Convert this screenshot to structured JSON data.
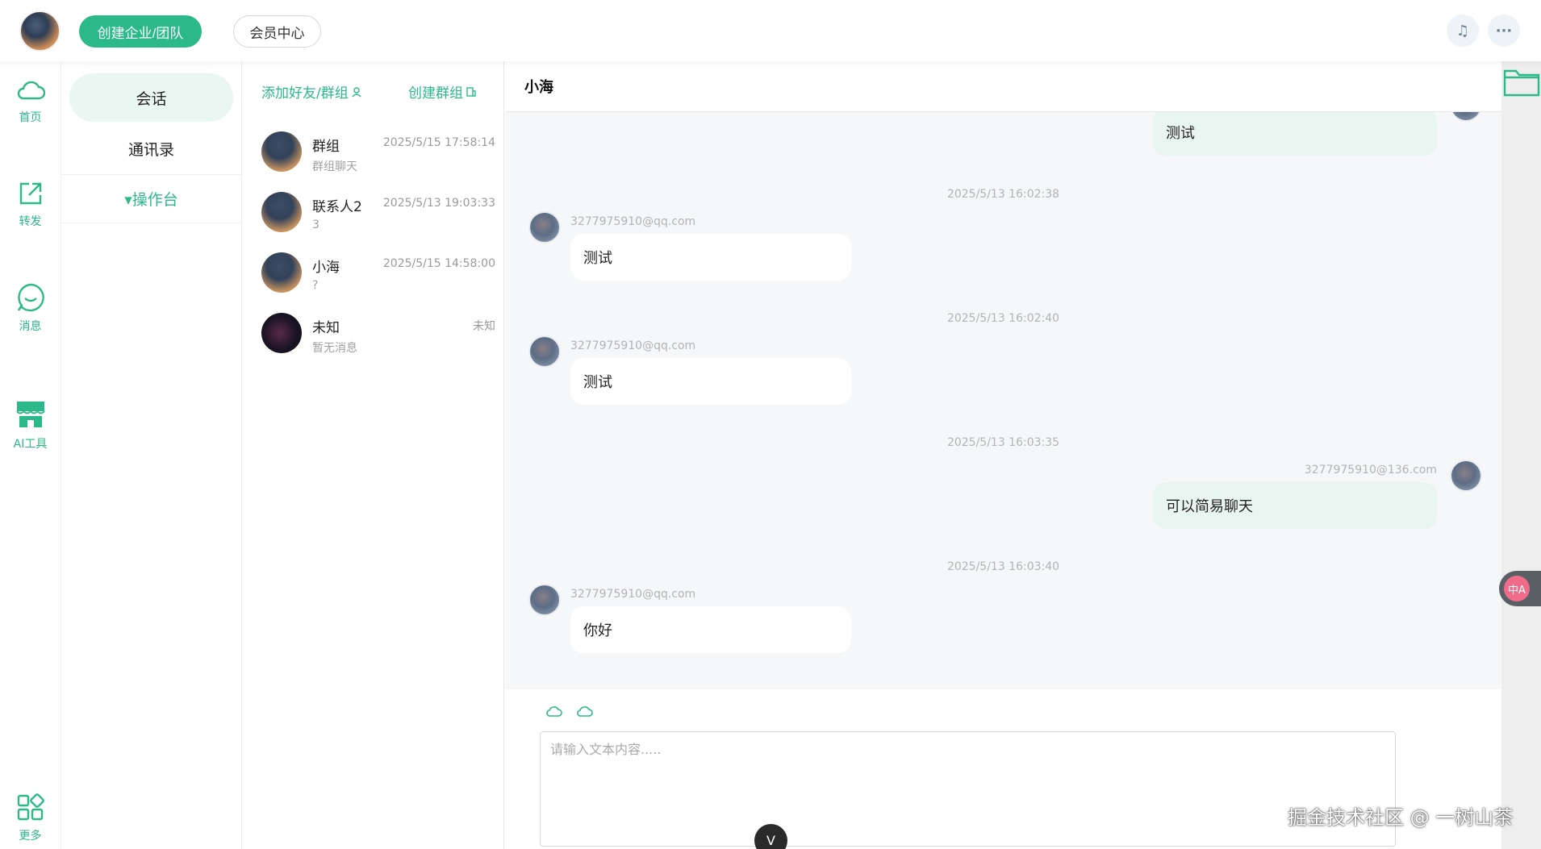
{
  "topbar": {
    "create_team_label": "创建企业/团队",
    "member_center_label": "会员中心",
    "icons": [
      "audio-icon",
      "more-icon"
    ],
    "more_glyph": "···",
    "audio_glyph": "♫"
  },
  "rail": {
    "items": [
      {
        "label": "首页",
        "icon": "cloud-icon"
      },
      {
        "label": "转发",
        "icon": "share-icon"
      },
      {
        "label": "消息",
        "icon": "message-icon"
      },
      {
        "label": "AI工具",
        "icon": "store-icon"
      },
      {
        "label": "更多",
        "icon": "grid-icon"
      }
    ]
  },
  "subnav": {
    "tabs": [
      "会话",
      "通讯录"
    ],
    "ops_label": "▾操作台"
  },
  "convlist": {
    "add_friend_label": "添加好友/群组",
    "create_group_label": "创建群组",
    "items": [
      {
        "name": "群组",
        "time": "2025/5/15 17:58:14",
        "preview": "群组聊天"
      },
      {
        "name": "联系人2",
        "time": "2025/5/13 19:03:33",
        "preview": "3"
      },
      {
        "name": "小海",
        "time": "2025/5/15 14:58:00",
        "preview": "?"
      },
      {
        "name": "未知",
        "time": "未知",
        "preview": "暂无消息"
      }
    ]
  },
  "chat": {
    "title": "小海",
    "messages": [
      {
        "dir": "out",
        "text": "测试"
      },
      {
        "dir": "in",
        "time": "2025/5/13 16:02:38",
        "sender": "3277975910@qq.com",
        "text": "测试"
      },
      {
        "dir": "in",
        "time": "2025/5/13 16:02:40",
        "sender": "3277975910@qq.com",
        "text": "测试"
      },
      {
        "dir": "out",
        "time": "2025/5/13 16:03:35",
        "sender": "3277975910@136.com",
        "text": "可以简易聊天"
      },
      {
        "dir": "in",
        "time": "2025/5/13 16:03:40",
        "sender": "3277975910@qq.com",
        "text": "你好"
      }
    ],
    "input_placeholder": "请输入文本内容....."
  },
  "float_translate_label": "中A",
  "scroll_down_label": "V",
  "watermark": "掘金技术社区 @ 一树山茶",
  "colors": {
    "accent": "#2bb989",
    "bubble_out": "#e9f5f0",
    "chat_bg": "#f6f7f9"
  }
}
